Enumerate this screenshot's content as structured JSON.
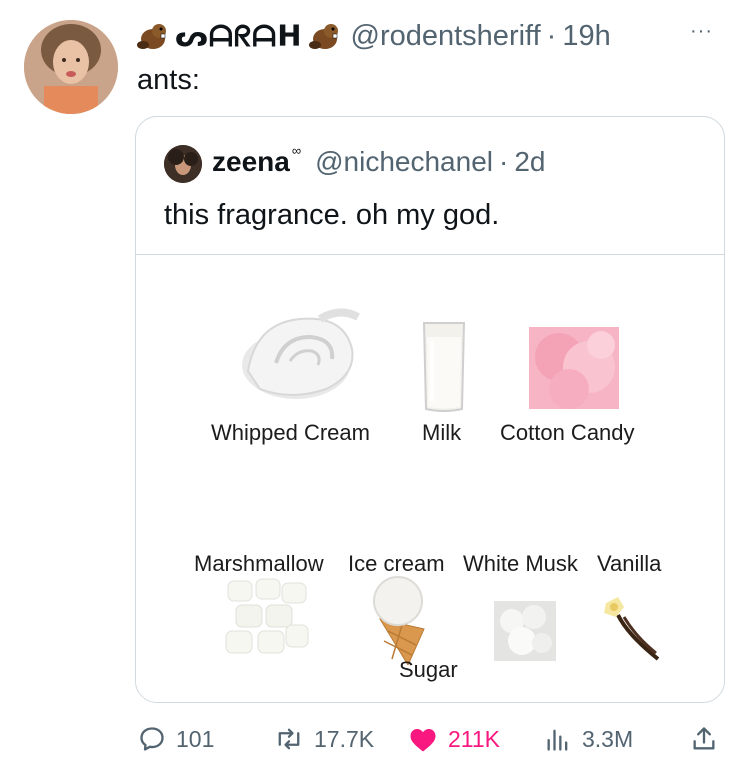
{
  "tweet": {
    "display_name": "ᔕᗩᖇᗩᕼ",
    "handle": "@rodentsheriff",
    "separator": "·",
    "time": "19h",
    "more_label": "···",
    "text": "ants:"
  },
  "quote": {
    "display_name": "zeena",
    "name_suffix": "∞",
    "handle": "@nichechanel",
    "separator": "·",
    "time": "2d",
    "text": "this fragrance. oh my god."
  },
  "notes": {
    "whipped_cream": "Whipped Cream",
    "milk": "Milk",
    "cotton_candy": "Cotton Candy",
    "marshmallow": "Marshmallow",
    "ice_cream": "Ice cream",
    "white_musk": "White Musk",
    "vanilla": "Vanilla",
    "sugar": "Sugar"
  },
  "actions": {
    "replies": "101",
    "retweets": "17.7K",
    "likes": "211K",
    "views": "3.3M"
  },
  "colors": {
    "text": "#0f1419",
    "secondary": "#536471",
    "border": "#cfd9de",
    "like": "#f91880"
  },
  "icons": [
    "reply-icon",
    "retweet-icon",
    "heart-icon",
    "views-icon",
    "share-icon",
    "beaver-emoji-icon"
  ]
}
